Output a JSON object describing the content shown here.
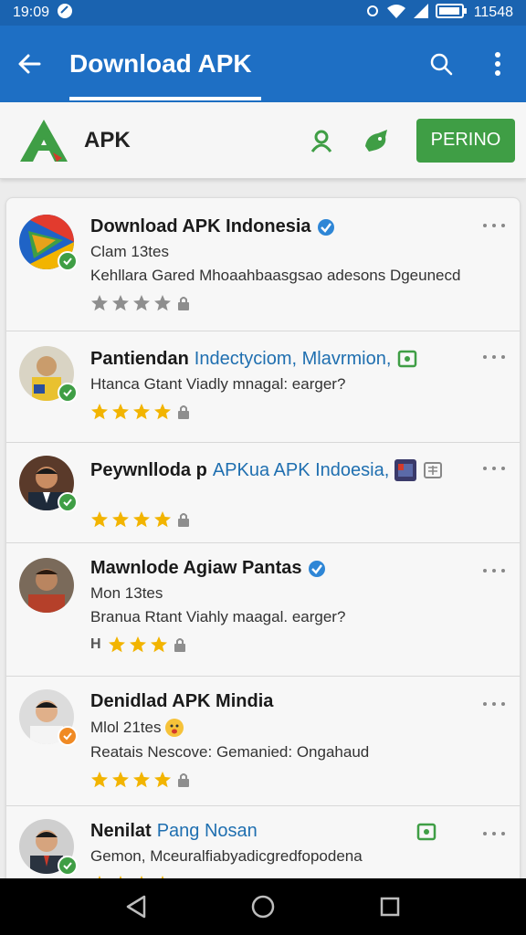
{
  "status_bar": {
    "time": "19:09",
    "battery_text": "11548"
  },
  "app_bar": {
    "title": "Download APK",
    "back_icon": "arrow-left-icon",
    "search_icon": "search-icon",
    "menu_icon": "more-vert-icon"
  },
  "sub_header": {
    "label": "APK",
    "primary_button": "PERINO"
  },
  "items": [
    {
      "title": "Download APK Indonesia",
      "title_accent": "",
      "line2": "Clam 13tes",
      "line3": "Kehllara Gared Mhoaahbaasgsao adesons Dgeunecd",
      "rating_prefix": "",
      "stars": 0
    },
    {
      "title": "Pantiendan",
      "title_accent": "Indectyciom, Mlavrmion,",
      "line2": "",
      "line3": "Htanca Gtant Viadly mnagal: earger?",
      "rating_prefix": "",
      "stars": 4
    },
    {
      "title": "Peywnlloda p",
      "title_accent": "APKua APK Indoesia,",
      "line2": "",
      "line3": "",
      "rating_prefix": "",
      "stars": 4
    },
    {
      "title": "Mawnlode Agiaw Pantas",
      "title_accent": "",
      "line2": "Mon 13tes",
      "line3": "Branua Rtant Viahly maagal. earger?",
      "rating_prefix": "H",
      "stars": 3
    },
    {
      "title": "Denidlad APK Mindia",
      "title_accent": "",
      "line2": "Mlol 21tes",
      "line3": "Reatais Nescove: Gemanied: Ongahaud",
      "rating_prefix": "",
      "stars": 4
    },
    {
      "title": "Nenilat",
      "title_accent": "Pang Nosan",
      "line2": "Gemon, Mceuralfiabyadicgredfopodena",
      "line3": "",
      "rating_prefix": "",
      "stars": 4
    }
  ],
  "colors": {
    "primary": "#1e6fc4",
    "status": "#1a63b0",
    "accent_green": "#3f9e45",
    "star": "#f2b400",
    "link": "#1f6fb0"
  }
}
